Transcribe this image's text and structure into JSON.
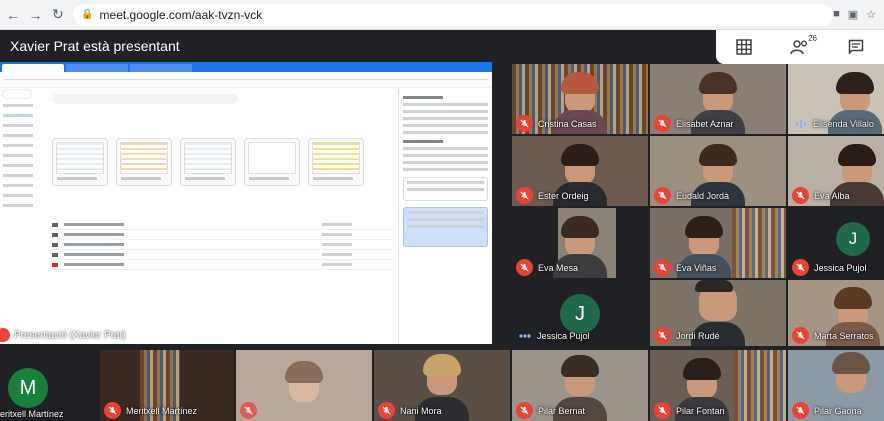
{
  "browser": {
    "url": "meet.google.com/aak-tvzn-vck"
  },
  "meet": {
    "presenter_title": "Xavier Prat està presentant",
    "participant_count": "26",
    "presentation_label": "Presentació (Xavier Prat)"
  },
  "participants": [
    {
      "name": "Cristina Casas",
      "muted": true
    },
    {
      "name": "Elisabet Aznar",
      "muted": true
    },
    {
      "name": "Elisenda Villalo",
      "muted": false,
      "speaking": true
    },
    {
      "name": "Ester Ordeig",
      "muted": true
    },
    {
      "name": "Eudald Jordà",
      "muted": true
    },
    {
      "name": "Eva Alba",
      "muted": true
    },
    {
      "name": "Eva Mesa",
      "muted": true
    },
    {
      "name": "Eva Viñas",
      "muted": true
    },
    {
      "name": "Jessica Pujol",
      "muted": true,
      "avatar_initial": "J",
      "avatar_color": "#1e6a4a"
    },
    {
      "name": "Jessica Pujol",
      "muted": false,
      "speaking": true,
      "avatar_initial": "J",
      "avatar_color": "#1e6a4a"
    },
    {
      "name": "Jordi Rudé",
      "muted": true
    },
    {
      "name": "Marta Serratos",
      "muted": true
    },
    {
      "name": "eritxell Martínez",
      "muted": false,
      "avatar_initial": "M",
      "avatar_color": "#188038"
    },
    {
      "name": "Meritxell Martínez",
      "muted": true
    },
    {
      "name": "Nani Mora",
      "muted": true
    },
    {
      "name": "Pilar Bernat",
      "muted": true
    },
    {
      "name": "Pilar Fontan",
      "muted": true
    },
    {
      "name": "Pilar Gaona",
      "muted": true
    }
  ],
  "colors": {
    "background": "#202124",
    "mic_off": "#ea4335",
    "accent": "#1a73e8"
  }
}
